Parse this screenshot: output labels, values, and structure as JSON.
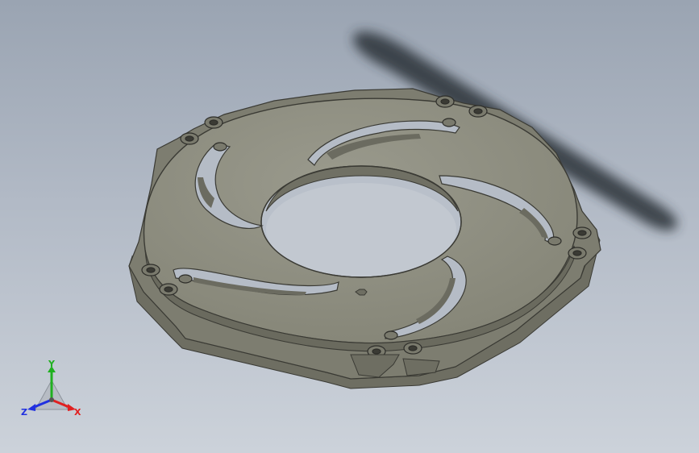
{
  "viewport": {
    "background_top": "#9aa4b2",
    "background_bottom": "#ccd2da"
  },
  "model": {
    "part_color": "#8f8f82",
    "edge_color": "#3a3a34"
  },
  "triad": {
    "x_label": "X",
    "y_label": "Y",
    "z_label": "Z",
    "x_color": "#e02020",
    "y_color": "#20b020",
    "z_color": "#2030e0",
    "x_icon": "x-axis-arrow-icon",
    "y_icon": "y-axis-arrow-icon",
    "z_icon": "z-axis-arrow-icon"
  }
}
